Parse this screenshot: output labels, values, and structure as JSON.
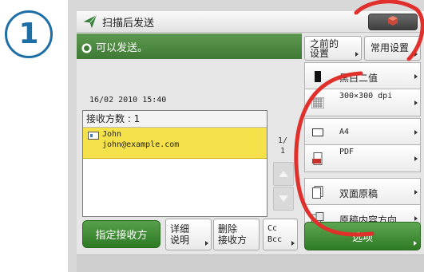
{
  "step_badge": "1",
  "titlebar": {
    "title": "扫描后发送"
  },
  "status": {
    "message": "可以发送。"
  },
  "datetime": "16/02 2010 15:40",
  "destinations": {
    "header": "接收方数   : 1",
    "items": [
      {
        "name": "John",
        "email": "john@example.com"
      }
    ],
    "page_current": "1/",
    "page_total": "1"
  },
  "buttons": {
    "specify": "指定接收方",
    "detail_line1": "详细",
    "detail_line2": "说明",
    "delete_line1": "删除",
    "delete_line2": "接收方",
    "cc_line1": "Cc",
    "cc_line2": "Bcc",
    "prev_line1": "之前的",
    "prev_line2": "设置",
    "common": "常用设置",
    "options": "选项"
  },
  "settings": [
    {
      "icon": "color-mode-icon",
      "label": "黑白二值"
    },
    {
      "icon": "resolution-icon",
      "label": "300×300 dpi"
    },
    {
      "icon": "paper-size-icon",
      "label": "A4"
    },
    {
      "icon": "file-format-icon",
      "label": "PDF"
    },
    {
      "icon": "duplex-icon",
      "label": "双面原稿"
    },
    {
      "icon": "orientation-icon",
      "label": "原稿内容方向"
    }
  ],
  "colors": {
    "accent_green": "#3e7a34",
    "selection_yellow": "#f5e24a",
    "badge_blue": "#1d6fa5",
    "annotation_red": "#e0302c"
  }
}
